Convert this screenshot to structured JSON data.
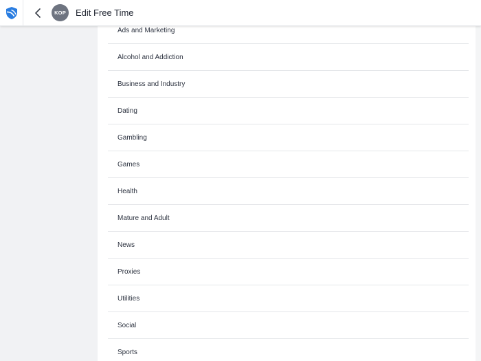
{
  "header": {
    "title": "Edit Free Time",
    "avatar_initials": "KOP",
    "logo_icon": "shield-logo-icon",
    "back_icon": "chevron-left-icon",
    "brand_color": "#2a7de1"
  },
  "categories": [
    "Ads and Marketing",
    "Alcohol and Addiction",
    "Business and Industry",
    "Dating",
    "Gambling",
    "Games",
    "Health",
    "Mature and Adult",
    "News",
    "Proxies",
    "Utilities",
    "Social",
    "Sports"
  ]
}
